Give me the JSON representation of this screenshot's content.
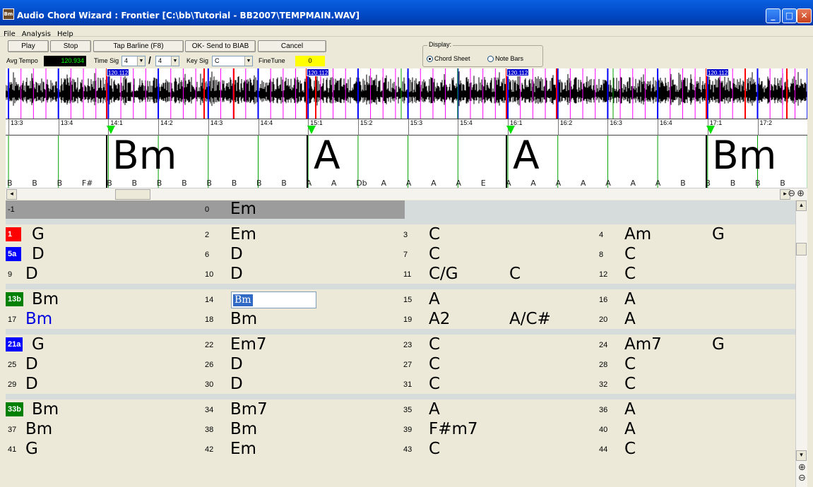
{
  "window": {
    "title": "Audio Chord Wizard : Frontier [C:\\bb\\Tutorial - BB2007\\TEMPMAIN.WAV]",
    "icon_text": "Bm",
    "minimize": "_",
    "maximize": "□",
    "close": "✕"
  },
  "menu": [
    "File",
    "Analysis",
    "Help"
  ],
  "toolbar": {
    "play": "Play",
    "stop": "Stop",
    "tap_barline": "Tap Barline (F8)",
    "ok_send": "OK- Send to BIAB",
    "cancel": "Cancel",
    "avg_tempo_label": "Avg Tempo",
    "avg_tempo_value": "120.934",
    "time_sig_label": "Time Sig",
    "time_sig_num": "4",
    "time_sig_slash": "/",
    "time_sig_den": "4",
    "key_sig_label": "Key Sig",
    "key_sig_value": "C",
    "finetune_label": "FineTune",
    "finetune_value": "0",
    "display_label": "Display:",
    "display_chord_sheet": "Chord Sheet",
    "display_note_bars": "Note Bars",
    "display_selected": "Chord Sheet"
  },
  "waveform": {
    "tempo_tags": [
      "120.112",
      "120.112",
      "120.112",
      "120.112"
    ]
  },
  "ruler": {
    "beats": [
      "13:3",
      "13:4",
      "14:1",
      "14:2",
      "14:3",
      "14:4",
      "15:1",
      "15:2",
      "15:3",
      "15:4",
      "16:1",
      "16:2",
      "16:3",
      "16:4",
      "17:1",
      "17:2"
    ]
  },
  "chord_strip": {
    "big_chords": [
      "Bm",
      "A",
      "A",
      "Bm"
    ],
    "beat_notes": [
      "B",
      "B",
      "B",
      "F#",
      "B",
      "B",
      "B",
      "B",
      "B",
      "B",
      "B",
      "B",
      "A",
      "A",
      "Db",
      "A",
      "A",
      "A",
      "A",
      "E",
      "A",
      "A",
      "A",
      "A",
      "A",
      "A",
      "A",
      "B",
      "B",
      "B",
      "B",
      "B"
    ]
  },
  "sheet": {
    "header_row": {
      "left_num": "-1",
      "mid_num": "0",
      "mid_chord": "Em"
    },
    "rows": [
      {
        "cells": [
          {
            "num": "1",
            "chord": "G",
            "hl": "red"
          },
          {
            "num": "2",
            "chord": "Em"
          },
          {
            "num": "3",
            "chord": "C"
          },
          {
            "num": "4",
            "chord": "Am",
            "chord2": "G"
          }
        ]
      },
      {
        "cells": [
          {
            "num": "5a",
            "chord": "D",
            "hl": "blue"
          },
          {
            "num": "6",
            "chord": "D"
          },
          {
            "num": "7",
            "chord": "C"
          },
          {
            "num": "8",
            "chord": "C"
          }
        ]
      },
      {
        "cells": [
          {
            "num": "9",
            "chord": "D"
          },
          {
            "num": "10",
            "chord": "D"
          },
          {
            "num": "11",
            "chord": "C/G",
            "chord2": "C"
          },
          {
            "num": "12",
            "chord": "C"
          }
        ]
      },
      {
        "cells": [
          {
            "num": "13b",
            "chord": "Bm",
            "hl": "green"
          },
          {
            "num": "14",
            "chord": "Bm",
            "editing": true
          },
          {
            "num": "15",
            "chord": "A"
          },
          {
            "num": "16",
            "chord": "A"
          }
        ]
      },
      {
        "cells": [
          {
            "num": "17",
            "chord": "Bm",
            "blue": true
          },
          {
            "num": "18",
            "chord": "Bm"
          },
          {
            "num": "19",
            "chord": "A2",
            "chord2": "A/C#"
          },
          {
            "num": "20",
            "chord": "A"
          }
        ]
      },
      {
        "cells": [
          {
            "num": "21a",
            "chord": "G",
            "hl": "blue"
          },
          {
            "num": "22",
            "chord": "Em7"
          },
          {
            "num": "23",
            "chord": "C"
          },
          {
            "num": "24",
            "chord": "Am7",
            "chord2": "G"
          }
        ]
      },
      {
        "cells": [
          {
            "num": "25",
            "chord": "D"
          },
          {
            "num": "26",
            "chord": "D"
          },
          {
            "num": "27",
            "chord": "C"
          },
          {
            "num": "28",
            "chord": "C"
          }
        ]
      },
      {
        "cells": [
          {
            "num": "29",
            "chord": "D"
          },
          {
            "num": "30",
            "chord": "D"
          },
          {
            "num": "31",
            "chord": "C"
          },
          {
            "num": "32",
            "chord": "C"
          }
        ]
      },
      {
        "cells": [
          {
            "num": "33b",
            "chord": "Bm",
            "hl": "green"
          },
          {
            "num": "34",
            "chord": "Bm7"
          },
          {
            "num": "35",
            "chord": "A"
          },
          {
            "num": "36",
            "chord": "A"
          }
        ]
      },
      {
        "cells": [
          {
            "num": "37",
            "chord": "Bm"
          },
          {
            "num": "38",
            "chord": "Bm"
          },
          {
            "num": "39",
            "chord": "F#m7"
          },
          {
            "num": "40",
            "chord": "A"
          }
        ]
      },
      {
        "cells": [
          {
            "num": "41",
            "chord": "G"
          },
          {
            "num": "42",
            "chord": "Em"
          },
          {
            "num": "43",
            "chord": "C"
          },
          {
            "num": "44",
            "chord": "C"
          }
        ]
      }
    ]
  },
  "colors": {
    "red": "#ff0000",
    "blue": "#0000ff",
    "green": "#008000",
    "tempo_bg": "#000000",
    "tempo_fg": "#00ff00",
    "finetune_bg": "#ffff00"
  },
  "icons": {
    "scroll_left": "◂",
    "scroll_right": "▸",
    "scroll_up": "▴",
    "scroll_down": "▾",
    "zoom_in": "⊕",
    "zoom_out": "⊖"
  }
}
